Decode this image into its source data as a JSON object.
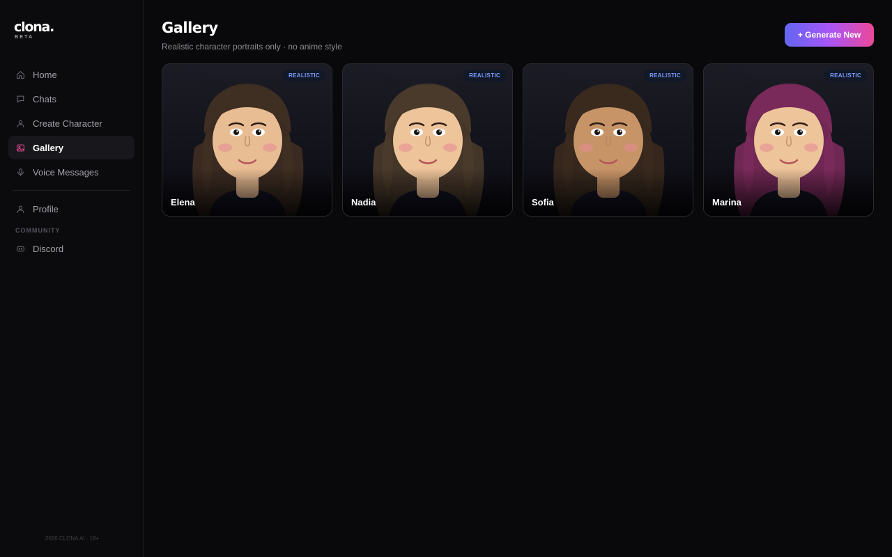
{
  "brand": {
    "name": "clona.",
    "tag": "BETA"
  },
  "sidebar": {
    "items": [
      {
        "label": "Home",
        "icon": "home-icon",
        "active": false
      },
      {
        "label": "Chats",
        "icon": "chat-bubble-icon",
        "active": false
      },
      {
        "label": "Create Character",
        "icon": "user-icon",
        "active": false
      },
      {
        "label": "Gallery",
        "icon": "image-icon",
        "active": true
      },
      {
        "label": "Voice Messages",
        "icon": "microphone-icon",
        "active": false
      }
    ],
    "secondary": [
      {
        "label": "Profile",
        "icon": "user-icon"
      }
    ],
    "community_label": "COMMUNITY",
    "community": [
      {
        "label": "Discord",
        "icon": "discord-icon"
      }
    ],
    "footer": "2026 CLONA AI · 18+"
  },
  "header": {
    "title": "Gallery",
    "subtitle": "Realistic character portraits only · no anime style",
    "generate_label": "+ Generate New"
  },
  "gallery": {
    "cards": [
      {
        "name": "Elena",
        "badge": "REALISTIC",
        "hair": "#3f2e22",
        "skin": "#e9bd93"
      },
      {
        "name": "Nadia",
        "badge": "REALISTIC",
        "hair": "#4a3a2b",
        "skin": "#eec49a"
      },
      {
        "name": "Sofia",
        "badge": "REALISTIC",
        "hair": "#3a2a1e",
        "skin": "#c79468"
      },
      {
        "name": "Marina",
        "badge": "REALISTIC",
        "hair": "#7a2a5a",
        "skin": "#eec49a"
      }
    ]
  },
  "colors": {
    "accent": "#ec4899",
    "gradient_start": "#6366f1",
    "gradient_end": "#ec4899",
    "badge_text": "#7c9cff",
    "background": "#09090b"
  }
}
